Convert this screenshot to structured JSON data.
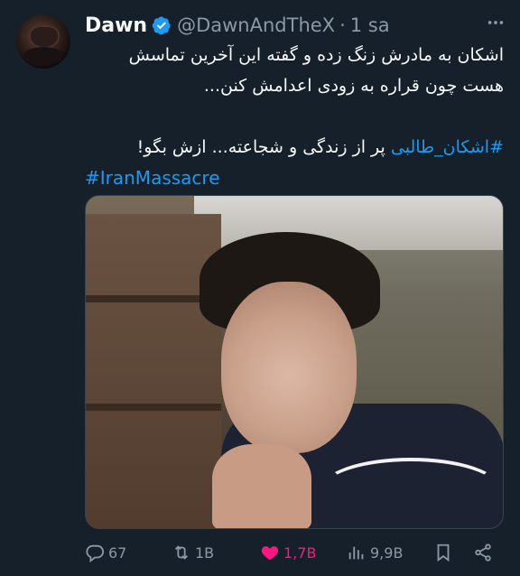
{
  "author": {
    "display_name": "Dawn",
    "handle": "@DawnAndTheX",
    "separator": "·",
    "timestamp": "1 sa"
  },
  "body": {
    "line1": "اشکان به مادرش زنگ زده و گفته این آخرین تماسش",
    "line2": "هست چون قراره به زودی اعدامش کنن...",
    "line3_tag": "#اشکان_طالبی",
    "line3_text": " پر از زندگی و شجاعته... ازش بگو",
    "line3_end": "!",
    "line4_tag": "#IranMassacre"
  },
  "actions": {
    "replies": "67",
    "retweets": "1B",
    "likes": "1,7B",
    "views": "9,9B"
  },
  "colors": {
    "background": "#15202b",
    "accent": "#1d9bf0",
    "like": "#f91880",
    "muted": "#8b98a5"
  },
  "icons": [
    "verified-badge-icon",
    "more-icon",
    "reply-icon",
    "retweet-icon",
    "like-icon",
    "views-icon",
    "bookmark-icon",
    "share-icon"
  ]
}
